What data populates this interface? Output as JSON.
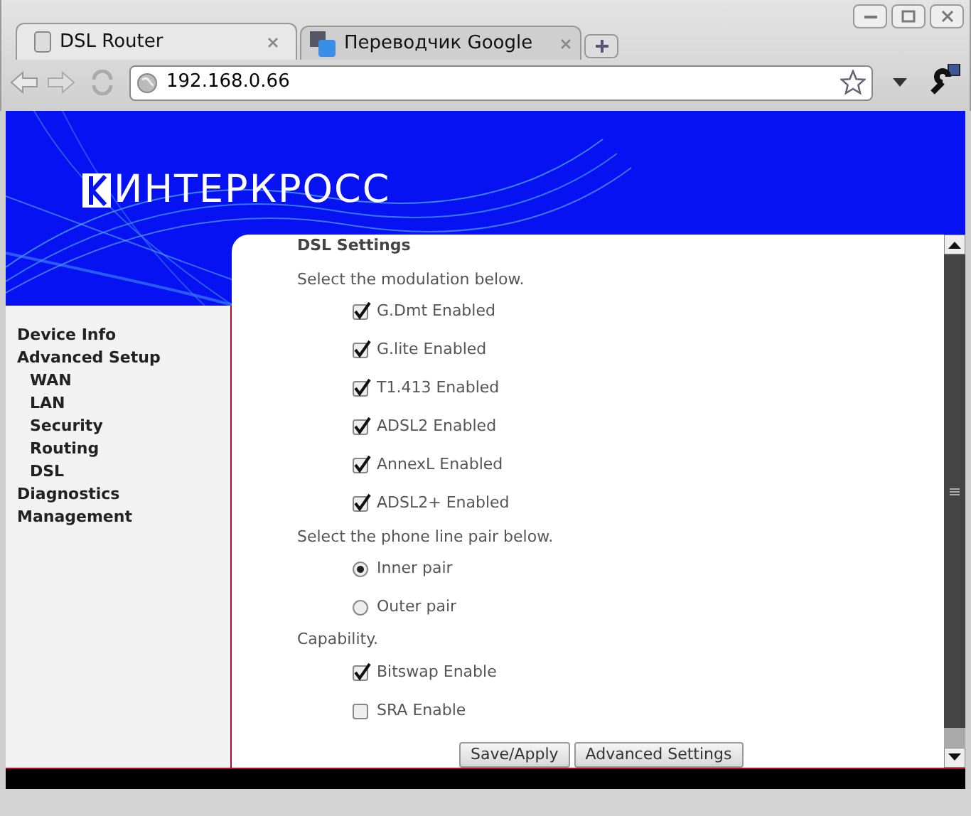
{
  "browser": {
    "tabs": [
      {
        "title": "DSL Router",
        "selected": true
      },
      {
        "title": "Переводчик Google",
        "selected": false
      }
    ],
    "address": "192.168.0.66"
  },
  "logo": {
    "text": "ИНТЕРКРОСС"
  },
  "sidebar": {
    "items": [
      {
        "label": "Device Info"
      },
      {
        "label": "Advanced Setup",
        "children": [
          {
            "label": "WAN"
          },
          {
            "label": "LAN"
          },
          {
            "label": "Security"
          },
          {
            "label": "Routing"
          },
          {
            "label": "DSL"
          }
        ]
      },
      {
        "label": "Diagnostics"
      },
      {
        "label": "Management"
      }
    ]
  },
  "content": {
    "title": "DSL Settings",
    "modulation_prompt": "Select the modulation below.",
    "modulations": [
      {
        "label": "G.Dmt Enabled",
        "checked": true
      },
      {
        "label": "G.lite Enabled",
        "checked": true
      },
      {
        "label": "T1.413 Enabled",
        "checked": true
      },
      {
        "label": "ADSL2 Enabled",
        "checked": true
      },
      {
        "label": "AnnexL Enabled",
        "checked": true
      },
      {
        "label": "ADSL2+ Enabled",
        "checked": true
      }
    ],
    "pair_prompt": "Select the phone line pair below.",
    "pairs": [
      {
        "label": "Inner pair",
        "selected": true
      },
      {
        "label": "Outer pair",
        "selected": false
      }
    ],
    "capability_prompt": "Capability.",
    "capabilities": [
      {
        "label": "Bitswap Enable",
        "checked": true
      },
      {
        "label": "SRA Enable",
        "checked": false
      }
    ],
    "buttons": [
      "Save/Apply",
      "Advanced Settings"
    ]
  }
}
